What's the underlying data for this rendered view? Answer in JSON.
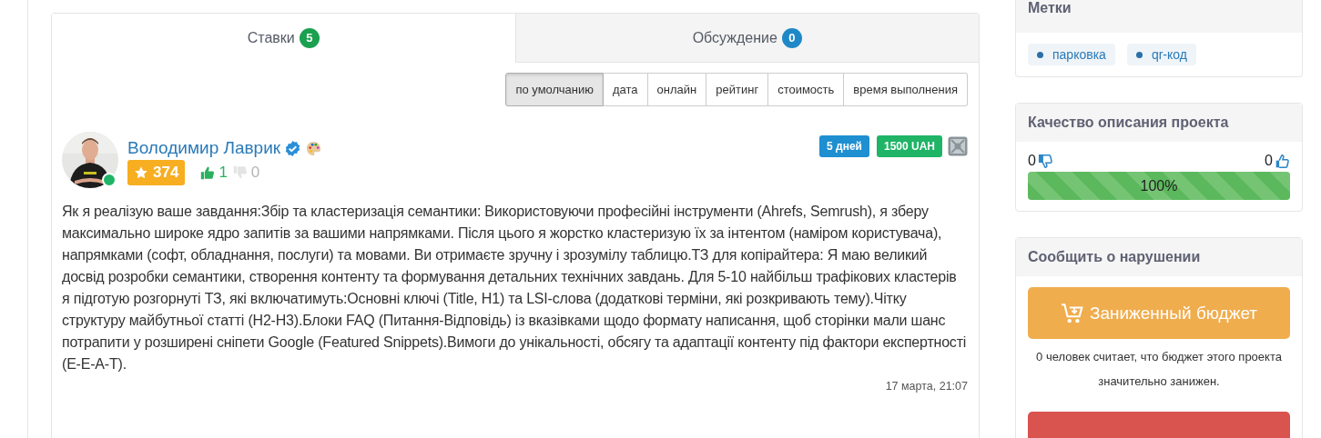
{
  "tabs": [
    {
      "label": "Ставки",
      "count": "5",
      "color": "#1aa04f",
      "selected": true
    },
    {
      "label": "Обсуждение",
      "count": "0",
      "color": "#1e88c7",
      "selected": false
    }
  ],
  "sort_options": [
    {
      "label": "по умолчанию",
      "selected": true
    },
    {
      "label": "дата",
      "selected": false
    },
    {
      "label": "онлайн",
      "selected": false
    },
    {
      "label": "рейтинг",
      "selected": false
    },
    {
      "label": "стоимость",
      "selected": false
    },
    {
      "label": "время выполнения",
      "selected": false
    }
  ],
  "bid": {
    "online": true,
    "name": "Володимир Лаврик",
    "verified": true,
    "rating": "374",
    "likes": "1",
    "dislikes": "0",
    "tags": [
      {
        "label": "5 дней",
        "color": "#1e8fd0"
      },
      {
        "label": "1500 UAH",
        "color": "#1fb466"
      }
    ],
    "text": "Як я реалізую ваше завдання:Збір та кластеризація семантики: Використовуючи професійні інструменти (Ahrefs, Semrush), я зберу максимально широке ядро запитів за вашими напрямками. Після цього я жорстко кластеризую їх за інтентом (наміром користувача), напрямками (софт, обладнання, послуги) та мовами. Ви отримаєте зручну і зрозумілу таблицю.ТЗ для копірайтера: Я маю великий досвід розробки семантики, створення контенту та формування детальних технічних завдань. Для 5-10 найбільш трафікових кластерів я підготую розгорнуті ТЗ, які включатимуть:Основні ключі (Title, H1) та LSI-слова (додаткові терміни, які розкривають тему).Чітку структуру майбутньої статті (H2-H3).Блоки FAQ (Питання-Відповідь) із вказівками щодо формату написання, щоб сторінки мали шанс потрапити у розширені сніпети Google (Featured Snippets).Вимоги до унікальності, обсягу та адаптації контенту під фактори експертності (E-E-A-T).",
    "date": "17 марта, 21:07"
  },
  "sidebar": {
    "tags_card": {
      "title": "Метки",
      "tags": [
        "парковка",
        "qr-код"
      ]
    },
    "quality_card": {
      "title": "Качество описания проекта",
      "dislikes": "0",
      "likes": "0",
      "level": 1.0,
      "reading": "100%"
    },
    "report_card": {
      "title": "Сообщить о нарушении",
      "button": "Заниженный бюджет",
      "note": "0 человек считает, что бюджет этого проекта значительно занижен."
    }
  }
}
